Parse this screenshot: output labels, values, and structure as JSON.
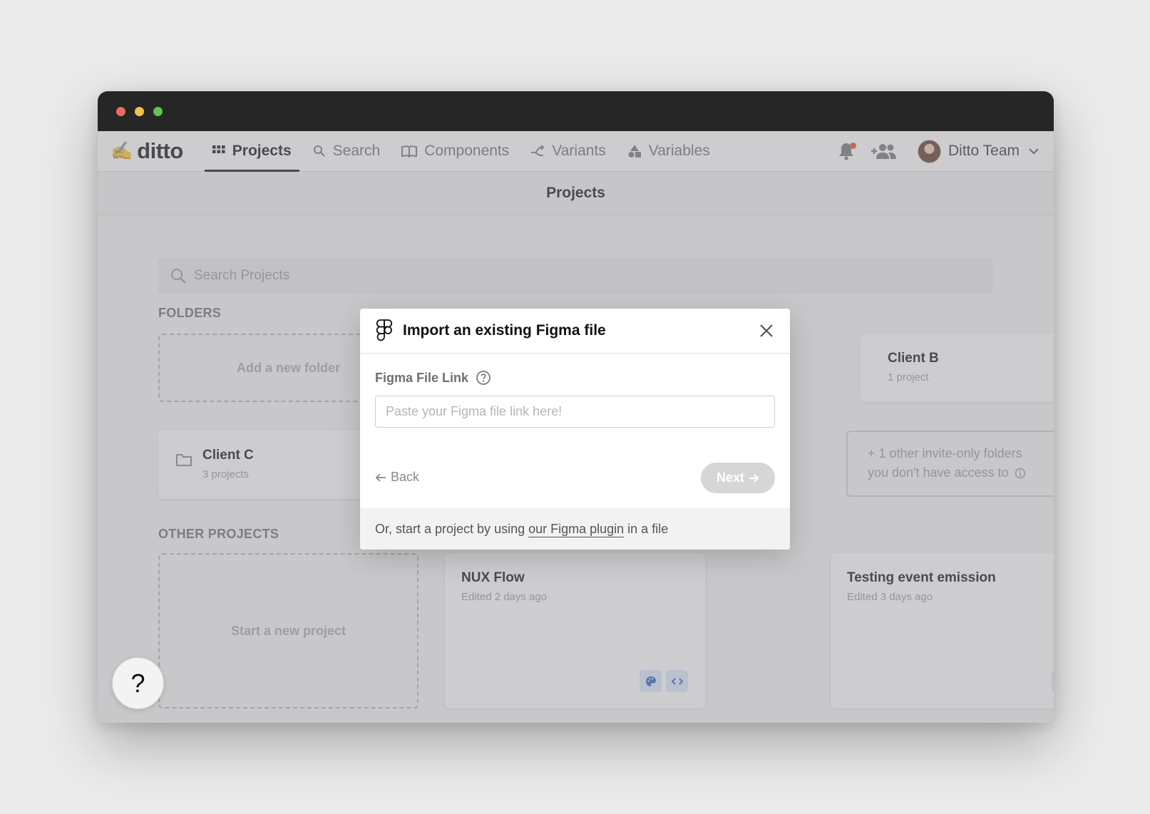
{
  "app": {
    "logo_text": "ditto",
    "logo_emoji": "✍️"
  },
  "nav": {
    "items": [
      {
        "label": "Projects",
        "icon": "grid-icon",
        "active": true
      },
      {
        "label": "Search",
        "icon": "search-icon",
        "active": false
      },
      {
        "label": "Components",
        "icon": "book-icon",
        "active": false
      },
      {
        "label": "Variants",
        "icon": "branch-icon",
        "active": false
      },
      {
        "label": "Variables",
        "icon": "shapes-icon",
        "active": false
      }
    ],
    "team_name": "Ditto Team"
  },
  "page": {
    "title": "Projects"
  },
  "search": {
    "placeholder": "Search Projects"
  },
  "folders": {
    "section_label": "FOLDERS",
    "add_label": "Add a new folder",
    "items": [
      {
        "name": "Client B",
        "sub": "1 project"
      },
      {
        "name": "Client C",
        "sub": "3 projects"
      }
    ],
    "invite_only_line1": "+ 1 other invite-only folders",
    "invite_only_line2": "you don't have access to"
  },
  "other_projects": {
    "section_label": "OTHER PROJECTS",
    "new_label": "Start a new project",
    "items": [
      {
        "name": "NUX Flow",
        "edited": "Edited 2 days ago"
      },
      {
        "name": "Testing event emission",
        "edited": "Edited 3 days ago"
      }
    ]
  },
  "help": {
    "label": "?"
  },
  "modal": {
    "title": "Import an existing Figma file",
    "field_label": "Figma File Link",
    "input_placeholder": "Paste your Figma file link here!",
    "input_value": "",
    "back_label": "Back",
    "next_label": "Next",
    "footer_prefix": "Or, start a project by using",
    "footer_link": "our Figma plugin",
    "footer_suffix": "in a file"
  },
  "colors": {
    "titlebar": "#262626",
    "traffic_red": "#ed6a5e",
    "traffic_yellow": "#f5bf4f",
    "traffic_green": "#61c554",
    "notification_dot": "#e4532f",
    "badge_blue": "#2f5fc4"
  }
}
